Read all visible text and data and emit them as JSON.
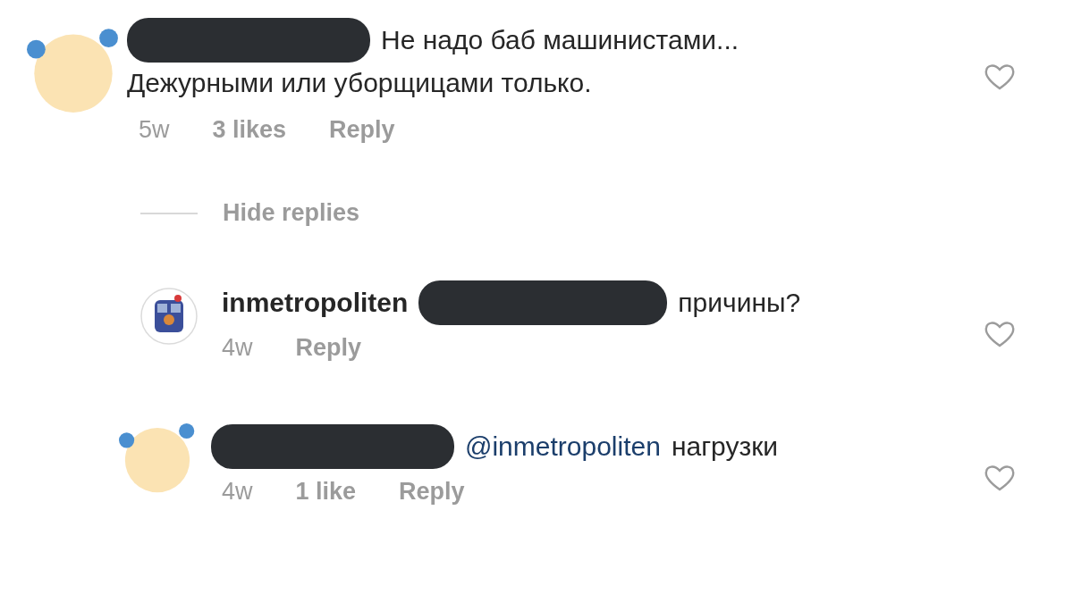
{
  "comment": {
    "kind": "clown",
    "username_hidden": true,
    "lines": [
      "Не надо баб машинистами...",
      "Дежурными или уборщицами только."
    ],
    "time": "5w",
    "likes": "3 likes",
    "reply": "Reply",
    "liked": false
  },
  "replies_toggle": "Hide replies",
  "replies": [
    {
      "kind": "train",
      "username": "inmetropoliten",
      "mention_hidden": true,
      "lines": [
        "причины?"
      ],
      "time": "4w",
      "reply": "Reply",
      "liked": false
    },
    {
      "kind": "clown",
      "username_hidden": true,
      "mention": "@inmetropoliten",
      "lines": [
        "нагрузки"
      ],
      "time": "4w",
      "likes": "1 like",
      "reply": "Reply",
      "liked": false
    }
  ]
}
